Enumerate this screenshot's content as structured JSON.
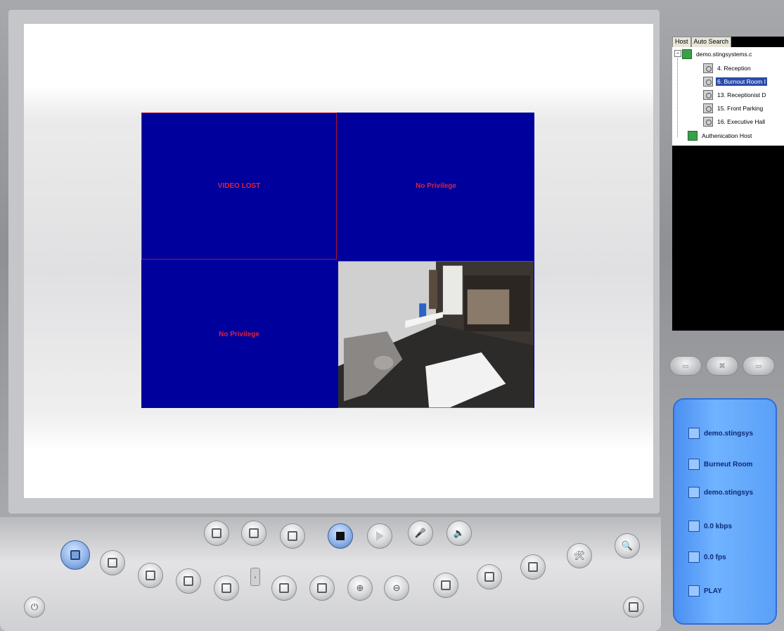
{
  "tree": {
    "tabs": [
      "Host",
      "Auto Search"
    ],
    "host": "demo.stingsystems.c",
    "cameras": [
      {
        "label": "4. Reception",
        "selected": false
      },
      {
        "label": "6. Burnout Room I",
        "selected": true
      },
      {
        "label": "13. Receptionist D",
        "selected": false
      },
      {
        "label": "15. Front Parking",
        "selected": false
      },
      {
        "label": "16. Executive Hall",
        "selected": false
      }
    ],
    "auth_host": "Authenication Host"
  },
  "grid": {
    "cells": [
      "VIDEO LOST",
      "No Privilege",
      "No Privilege"
    ]
  },
  "info": {
    "host": "demo.stingsys",
    "camera": "Burneut Room",
    "server": "demo.stingsys",
    "bitrate": "0.0 kbps",
    "framerate": "0.0 fps",
    "state": "PLAY"
  },
  "colors": {
    "video_bg": "#00009c",
    "warning_text": "#e0203a",
    "info_panel": "#5aa0f8",
    "selection": "#2a4ba8"
  },
  "icons": {
    "record": "camera-snapshot-icon",
    "save": "save-icon",
    "stop": "stop-icon",
    "play": "play-icon",
    "mic": "microphone-icon",
    "speaker": "speaker-icon"
  }
}
